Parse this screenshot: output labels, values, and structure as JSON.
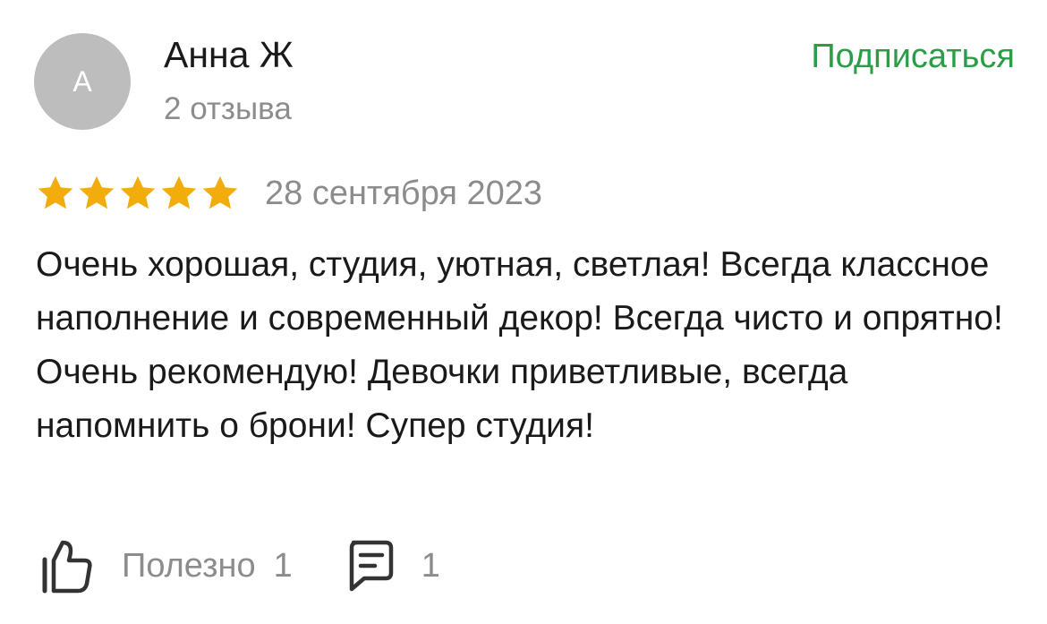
{
  "author": {
    "avatar_letter": "А",
    "name": "Анна Ж",
    "reviews_count": "2 отзыва"
  },
  "subscribe_label": "Подписаться",
  "review": {
    "rating": 5,
    "rating_max": 5,
    "date": "28 сентября 2023",
    "text": "Очень хорошая, студия, уютная, светлая! Всегда классное наполнение и современный декор! Всегда чисто и опрятно! Очень рекомендую! Девочки приветливые, всегда напомнить о брони! Супер студия!"
  },
  "actions": {
    "useful_label": "Полезно",
    "useful_count": "1",
    "comments_count": "1"
  },
  "colors": {
    "accent_green": "#2a9d46",
    "star": "#f2ad0c",
    "muted_text": "#8c8c8c",
    "avatar_bg": "#bdbdbd"
  },
  "icons": {
    "useful": "thumbs-up-icon",
    "comments": "comment-icon",
    "rating": "star-icon"
  }
}
